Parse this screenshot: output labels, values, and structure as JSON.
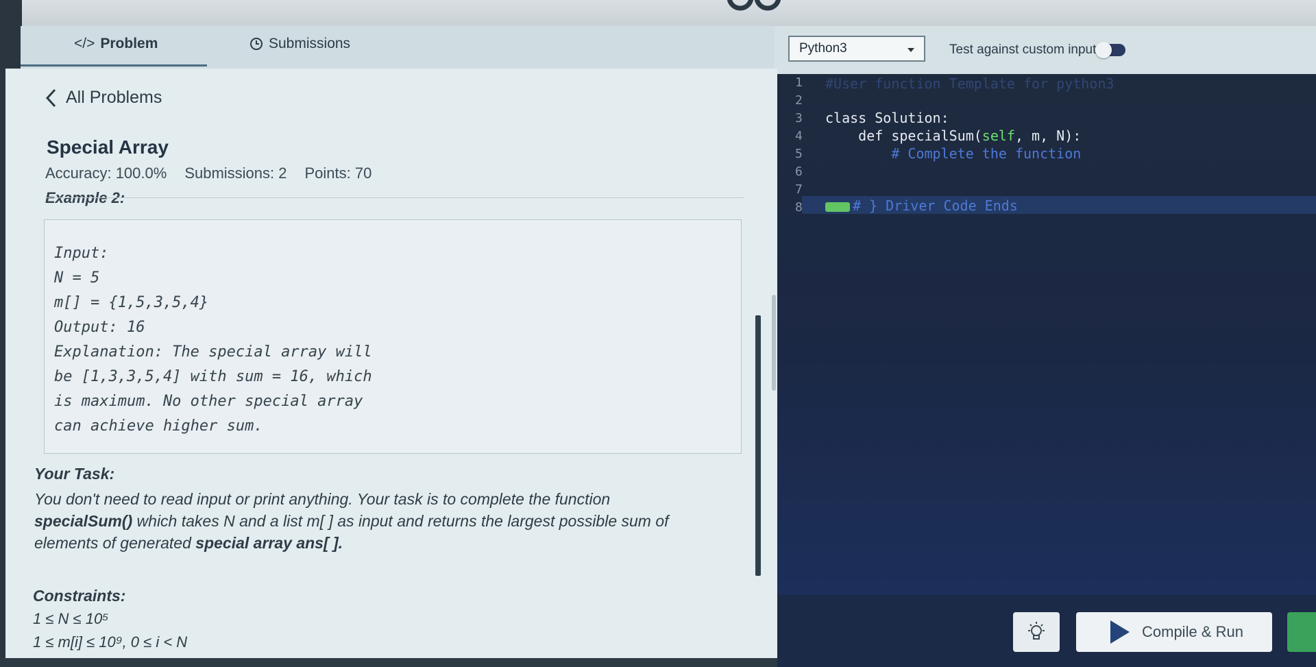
{
  "tabs": {
    "problem_label": "Problem",
    "submissions_label": "Submissions"
  },
  "toolbar": {
    "language": "Python3",
    "custom_input_label": "Test against custom input"
  },
  "problem": {
    "back_label": "All Problems",
    "title": "Special Array",
    "accuracy": "Accuracy: 100.0%",
    "submissions": "Submissions: 2",
    "points": "Points: 70",
    "example_heading": "Example 2:",
    "example_lines": [
      "Input:",
      "N = 5",
      "m[] = {1,5,3,5,4}",
      "Output: 16",
      "Explanation: The special array will",
      "be [1,3,3,5,4] with sum = 16, which",
      "is maximum. No other special array",
      "can achieve higher sum."
    ],
    "task_heading": "Your Task:",
    "task_line1": "You don't need to read input or print anything. Your task is to complete the function",
    "task_fn": "specialSum()",
    "task_line2": " which takes N and a list m[ ] as input and returns the largest possible sum of",
    "task_line3": "elements of generated ",
    "task_ans": "special array ans[ ].",
    "constraints_heading": "Constraints:",
    "constraint1": "1 ≤ N ≤ 10⁵",
    "constraint2": "1 ≤ m[i] ≤ 10⁹, 0 ≤ i < N"
  },
  "editor": {
    "line_numbers": [
      "1",
      "2",
      "3",
      "4",
      "5",
      "6",
      "7",
      "8"
    ],
    "line1": "#User function Template for python3",
    "line3": "class Solution:",
    "line4_a": "    def specialSum(",
    "line4_self": "self",
    "line4_b": ", m, N):",
    "line5": "        # Complete the function",
    "line8": "# } Driver Code Ends"
  },
  "actions": {
    "run_label": "Compile & Run"
  },
  "colors": {
    "accent_run": "#25457a",
    "submit_green": "#3aa25a"
  }
}
